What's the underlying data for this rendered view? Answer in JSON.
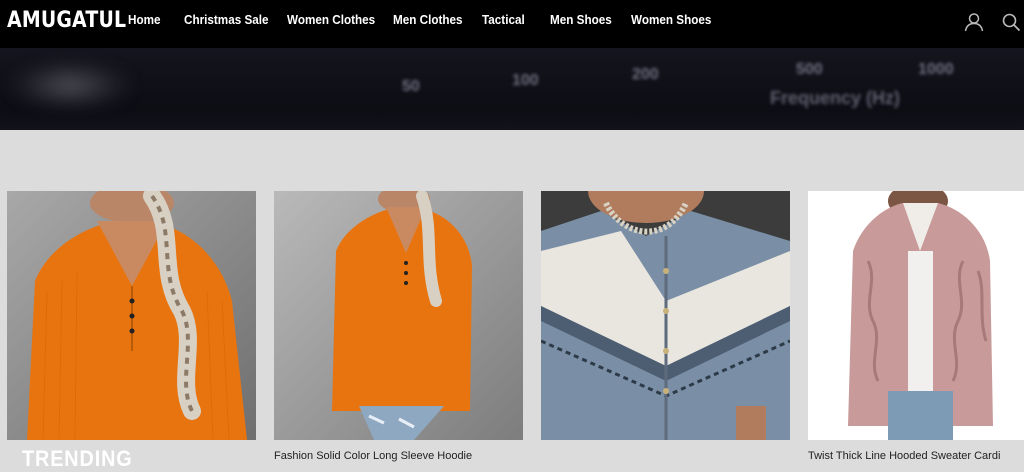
{
  "header": {
    "logo": "AMUGATUL",
    "nav": [
      {
        "label": "Home"
      },
      {
        "label": "Christmas Sale"
      },
      {
        "label": "Women Clothes"
      },
      {
        "label": "Men Clothes"
      },
      {
        "label": "Tactical"
      },
      {
        "label": "Men Shoes"
      },
      {
        "label": "Women Shoes"
      }
    ],
    "icons": [
      "user-icon",
      "search-icon"
    ]
  },
  "banner": {
    "frequency_ticks": [
      "50",
      "100",
      "200",
      "500",
      "1000"
    ],
    "frequency_label": "Frequency (Hz)"
  },
  "products": [
    {
      "title": "",
      "overlay": "TRENDING",
      "image": "orange-hoodie-photo"
    },
    {
      "title": "Fashion Solid Color Long Sleeve Hoodie",
      "image": "orange-hoodie-photo"
    },
    {
      "title": "",
      "image": "blue-striped-cardigan-photo"
    },
    {
      "title": "Twist Thick Line Hooded Sweater Cardi",
      "image": "pink-knit-cardigan-photo"
    }
  ],
  "colors": {
    "topbar": "#000000",
    "page_bg": "#dcdcdc",
    "hoodie_orange": "#e8740f",
    "cardigan_blue": "#7a8fa6",
    "cardigan_pink": "#c99a9a"
  }
}
